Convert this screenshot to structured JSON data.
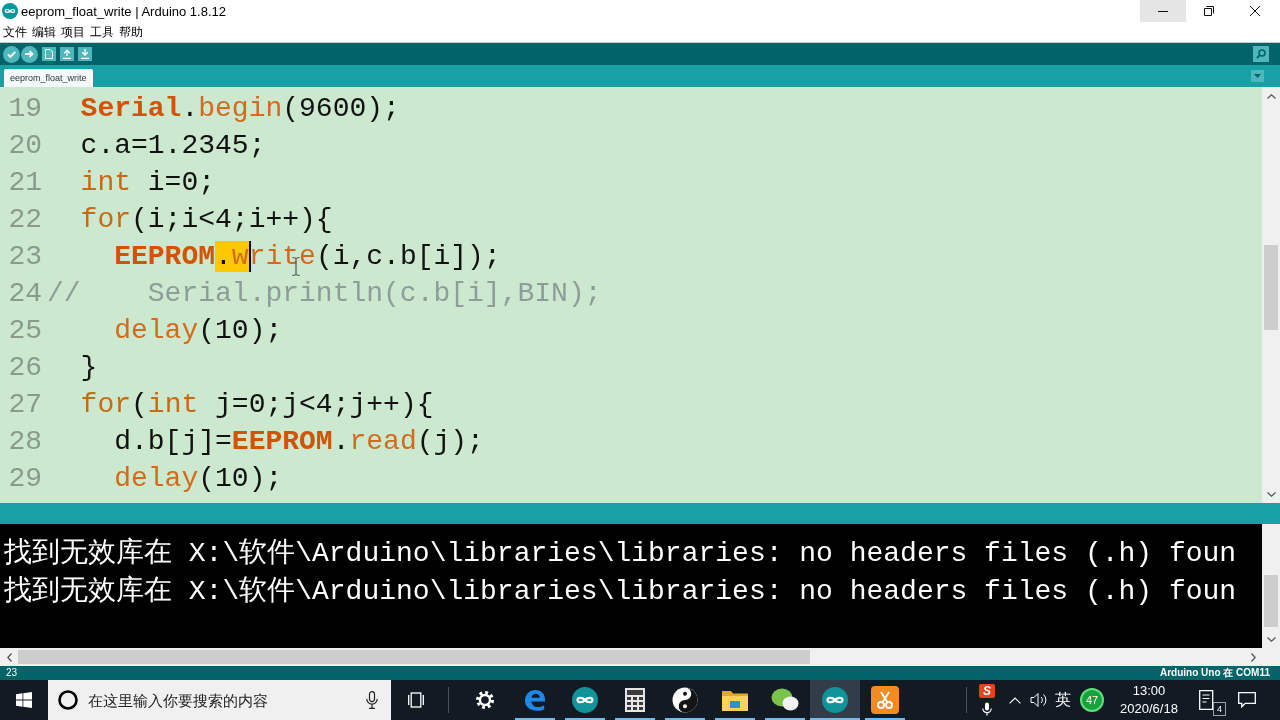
{
  "window": {
    "title": "eeprom_float_write | Arduino 1.8.12",
    "controls": [
      {
        "kind": "minimize",
        "hovered": true
      },
      {
        "kind": "restore",
        "hovered": false
      },
      {
        "kind": "close",
        "hovered": false
      }
    ]
  },
  "menu": [
    "文件",
    "编辑",
    "项目",
    "工具",
    "帮助"
  ],
  "tabs": [
    {
      "label": "eeprom_float_write",
      "selected": true
    }
  ],
  "editor": {
    "lines": [
      {
        "number": "19",
        "tokens": [
          {
            "text": "  Serial",
            "kind": "class"
          },
          {
            "text": ".",
            "kind": "plain"
          },
          {
            "text": "begin",
            "kind": "function"
          },
          {
            "text": "(9600);",
            "kind": "plain"
          }
        ]
      },
      {
        "number": "20",
        "tokens": [
          {
            "text": "  c.a=1.2345;",
            "kind": "plain"
          }
        ]
      },
      {
        "number": "21",
        "tokens": [
          {
            "text": "  int",
            "kind": "keyword"
          },
          {
            "text": " i=0;",
            "kind": "plain"
          }
        ]
      },
      {
        "number": "22",
        "tokens": [
          {
            "text": "  for",
            "kind": "keyword"
          },
          {
            "text": "(i;i<4;i++){",
            "kind": "plain"
          }
        ]
      },
      {
        "number": "23",
        "tokens": [
          {
            "text": "    EEPROM",
            "kind": "class"
          },
          {
            "text": ".",
            "kind": "plain",
            "highlighted": true
          },
          {
            "text": "w",
            "kind": "function",
            "highlighted": true,
            "caret": true
          },
          {
            "text": "rite",
            "kind": "function"
          },
          {
            "text": "(i,c.b[i]);",
            "kind": "plain"
          }
        ]
      },
      {
        "number": "24",
        "tokens": [
          {
            "text": "//    Serial.println(c.b[i],BIN);",
            "kind": "comment"
          }
        ]
      },
      {
        "number": "25",
        "tokens": [
          {
            "text": "    delay",
            "kind": "function"
          },
          {
            "text": "(10);",
            "kind": "plain"
          }
        ]
      },
      {
        "number": "26",
        "tokens": [
          {
            "text": "  }",
            "kind": "plain"
          }
        ]
      },
      {
        "number": "27",
        "tokens": [
          {
            "text": "  for",
            "kind": "keyword"
          },
          {
            "text": "(",
            "kind": "plain"
          },
          {
            "text": "int",
            "kind": "keyword"
          },
          {
            "text": " j=0;j<4;j++){",
            "kind": "plain"
          }
        ]
      },
      {
        "number": "28",
        "tokens": [
          {
            "text": "    d.b[j]=",
            "kind": "plain"
          },
          {
            "text": "EEPROM",
            "kind": "class"
          },
          {
            "text": ".",
            "kind": "plain"
          },
          {
            "text": "read",
            "kind": "function"
          },
          {
            "text": "(j);",
            "kind": "plain"
          }
        ]
      },
      {
        "number": "29",
        "tokens": [
          {
            "text": "    delay",
            "kind": "function"
          },
          {
            "text": "(10);",
            "kind": "plain"
          }
        ]
      }
    ]
  },
  "console": {
    "lines": [
      "找到无效库在 X:\\软件\\Arduino\\libraries\\libraries: no headers files (.h) foun",
      "找到无效库在 X:\\软件\\Arduino\\libraries\\libraries: no headers files (.h) foun"
    ]
  },
  "status_bar": {
    "line": "23",
    "board": "Arduino Uno 在 COM11"
  },
  "taskbar": {
    "search": {
      "placeholder": "在这里输入你要搜索的内容"
    },
    "apps": [
      {
        "kind": "settings",
        "running": false,
        "active": false
      },
      {
        "kind": "browser",
        "running": true,
        "active": false
      },
      {
        "kind": "arduino",
        "running": true,
        "active": false
      },
      {
        "kind": "calculator",
        "running": true,
        "active": false
      },
      {
        "kind": "yinyang",
        "running": true,
        "active": false
      },
      {
        "kind": "folder",
        "running": true,
        "active": false
      },
      {
        "kind": "chat",
        "running": true,
        "active": false
      },
      {
        "kind": "arduino",
        "running": true,
        "active": true
      },
      {
        "kind": "scissors",
        "running": true,
        "active": false
      }
    ],
    "tray": {
      "ime_logo": "S",
      "input_mode": "英",
      "badge": "47",
      "time": "13:00",
      "date": "2020/6/18",
      "notifications": "4"
    }
  }
}
